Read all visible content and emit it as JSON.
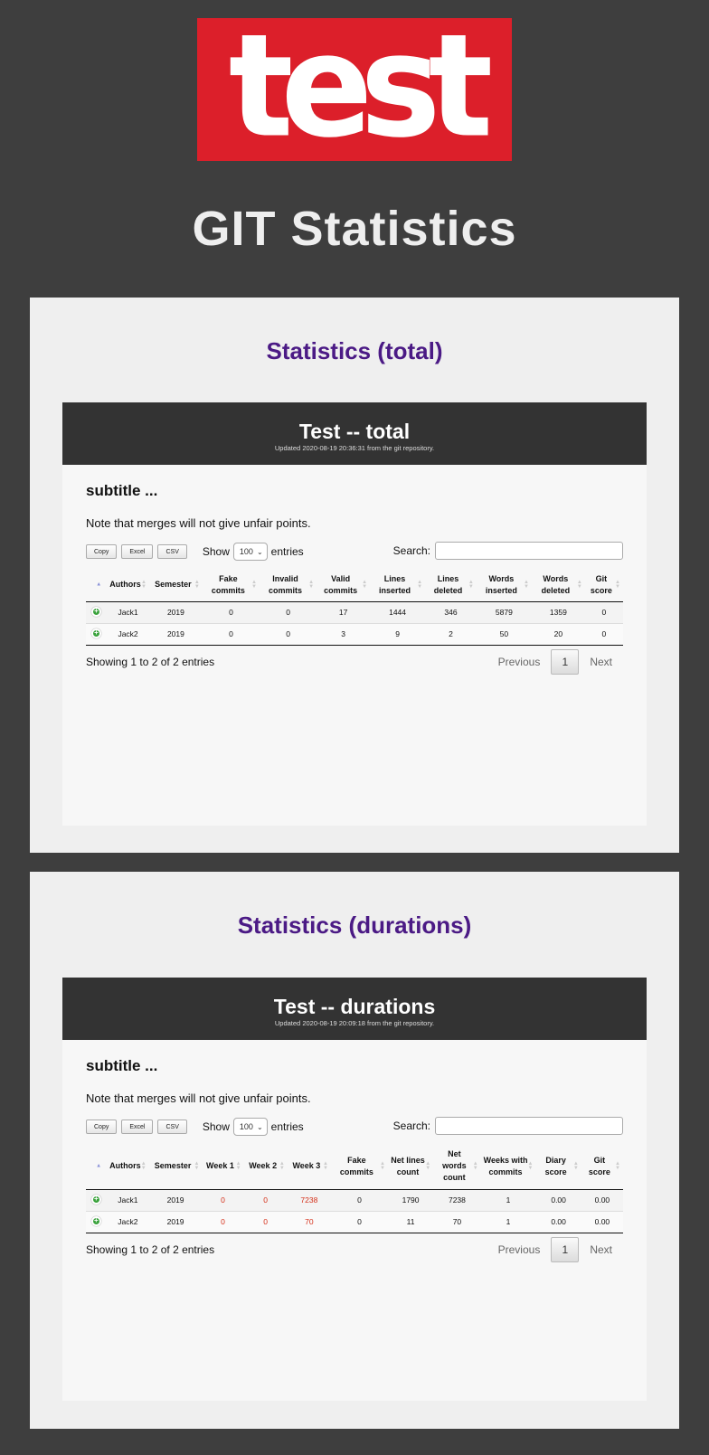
{
  "logo": {
    "text": "test"
  },
  "page_title": "GIT Statistics",
  "sections": [
    {
      "card_title": "Statistics (total)",
      "panel_title": "Test -- total",
      "panel_updated": "Updated 2020-08-19 20:36:31 from the git repository.",
      "subtitle": "subtitle ...",
      "note": "Note that merges will not give unfair points.",
      "buttons": [
        "Copy",
        "Excel",
        "CSV"
      ],
      "show_label": "Show",
      "entries_value": "100",
      "entries_label": "entries",
      "search_label": "Search:",
      "columns": [
        "Authors",
        "Semester",
        "Fake commits",
        "Invalid commits",
        "Valid commits",
        "Lines inserted",
        "Lines deleted",
        "Words inserted",
        "Words deleted",
        "Git score"
      ],
      "rows": [
        [
          "Jack1",
          "2019",
          "0",
          "0",
          "17",
          "1444",
          "346",
          "5879",
          "1359",
          "0"
        ],
        [
          "Jack2",
          "2019",
          "0",
          "0",
          "3",
          "9",
          "2",
          "50",
          "20",
          "0"
        ]
      ],
      "info": "Showing 1 to 2 of 2 entries",
      "pagination": {
        "previous": "Previous",
        "page": "1",
        "next": "Next"
      }
    },
    {
      "card_title": "Statistics (durations)",
      "panel_title": "Test -- durations",
      "panel_updated": "Updated 2020-08-19 20:09:18 from the git repository.",
      "subtitle": "subtitle ...",
      "note": "Note that merges will not give unfair points.",
      "buttons": [
        "Copy",
        "Excel",
        "CSV"
      ],
      "show_label": "Show",
      "entries_value": "100",
      "entries_label": "entries",
      "search_label": "Search:",
      "columns": [
        "Authors",
        "Semester",
        "Week 1",
        "Week 2",
        "Week 3",
        "Fake commits",
        "Net lines count",
        "Net words count",
        "Weeks with commits",
        "Diary score",
        "Git score"
      ],
      "rows": [
        [
          "Jack1",
          "2019",
          "0",
          "0",
          "7238",
          "0",
          "1790",
          "7238",
          "1",
          "0.00",
          "0.00"
        ],
        [
          "Jack2",
          "2019",
          "0",
          "0",
          "70",
          "0",
          "11",
          "70",
          "1",
          "0.00",
          "0.00"
        ]
      ],
      "red_columns": [
        2,
        3,
        4
      ],
      "info": "Showing 1 to 2 of 2 entries",
      "pagination": {
        "previous": "Previous",
        "page": "1",
        "next": "Next"
      }
    }
  ]
}
